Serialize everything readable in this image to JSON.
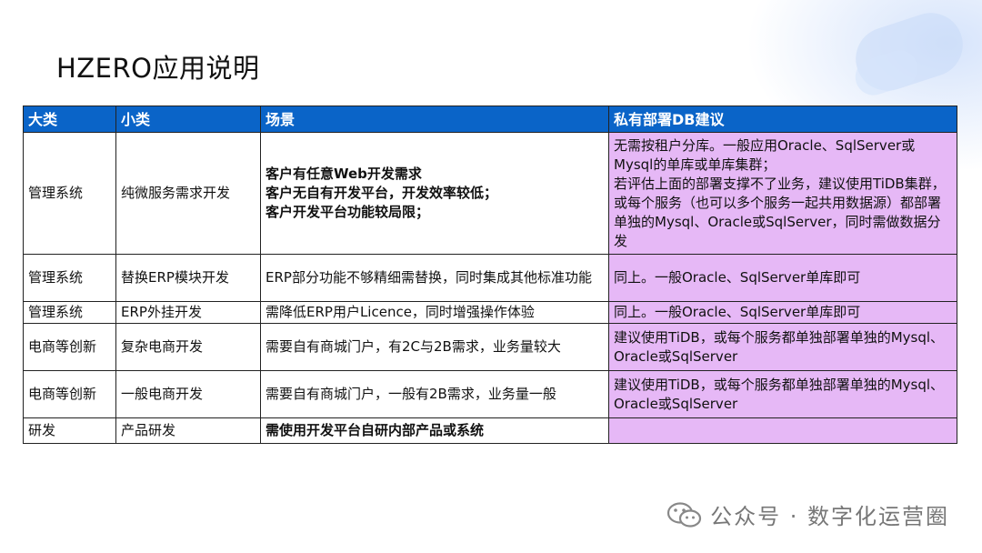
{
  "title": "HZERO应用说明",
  "table": {
    "headers": [
      "大类",
      "小类",
      "场景",
      "私有部署DB建议"
    ],
    "rows": [
      {
        "category": "管理系统",
        "subcategory": "纯微服务需求开发",
        "scenario": [
          "客户有任意Web开发需求",
          "客户无自有开发平台，开发效率较低；",
          "客户开发平台功能较局限；"
        ],
        "scenario_bold": true,
        "suggestion": [
          "无需按租户分库。一般应用Oracle、SqlServer或Mysql的单库或单库集群；",
          "若评估上面的部署支撑不了业务，建议使用TiDB集群，或每个服务（也可以多个服务一起共用数据源）都部署单独的Mysql、Oracle或SqlServer，同时需做数据分发"
        ],
        "suggestion_bold": false
      },
      {
        "category": "管理系统",
        "subcategory": "替换ERP模块开发",
        "scenario": [
          "ERP部分功能不够精细需替换，同时集成其他标准功能"
        ],
        "scenario_bold": false,
        "suggestion": [
          "同上。一般Oracle、SqlServer单库即可"
        ],
        "suggestion_bold": false
      },
      {
        "category": "管理系统",
        "subcategory": "ERP外挂开发",
        "scenario": [
          "需降低ERP用户Licence，同时增强操作体验"
        ],
        "scenario_bold": false,
        "suggestion": [
          "同上。一般Oracle、SqlServer单库即可"
        ],
        "suggestion_bold": false
      },
      {
        "category": "电商等创新",
        "subcategory": "复杂电商开发",
        "scenario": [
          "需要自有商城门户，有2C与2B需求，业务量较大"
        ],
        "scenario_bold": false,
        "suggestion": [
          "建议使用TiDB，或每个服务都单独部署单独的Mysql、Oracle或SqlServer"
        ],
        "suggestion_bold": false
      },
      {
        "category": "电商等创新",
        "subcategory": "一般电商开发",
        "scenario": [
          "需要自有商城门户，一般有2B需求，业务量一般"
        ],
        "scenario_bold": false,
        "suggestion": [
          "建议使用TiDB，或每个服务都单独部署单独的Mysql、Oracle或SqlServer"
        ],
        "suggestion_bold": false
      },
      {
        "category": "研发",
        "subcategory": "产品研发",
        "scenario": [
          "需使用开发平台自研内部产品或系统"
        ],
        "scenario_bold": true,
        "suggestion": [],
        "suggestion_bold": false
      }
    ]
  },
  "watermark": {
    "text": "公众号 · 数字化运营圈",
    "icon": "wechat-icon"
  }
}
